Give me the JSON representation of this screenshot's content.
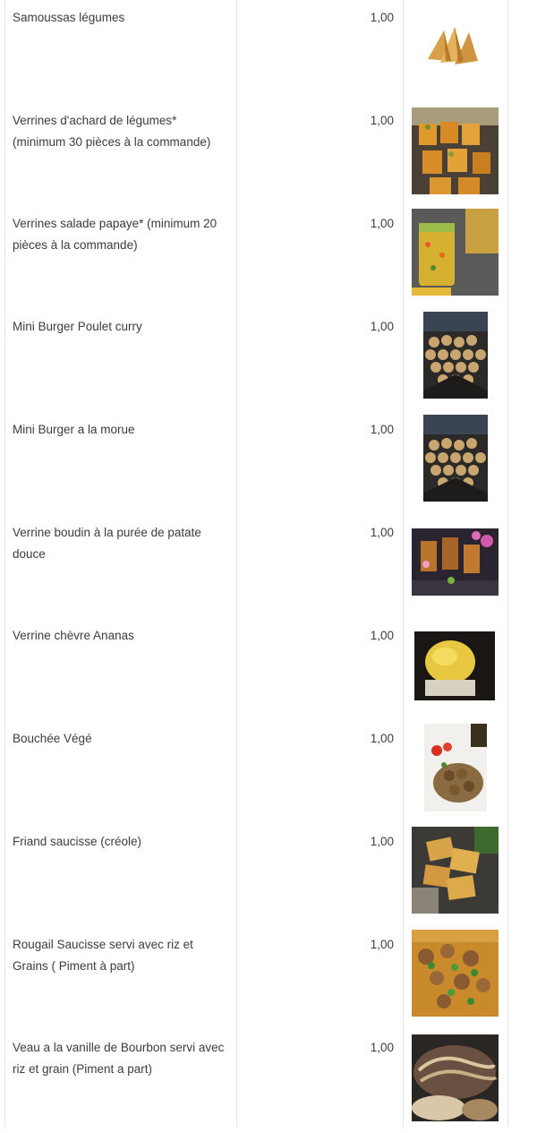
{
  "products": [
    {
      "name": "Samoussas légumes",
      "price": "1,00",
      "image": "samosa-icon"
    },
    {
      "name": "Verrines d'achard de légumes* (minimum 30 pièces à la commande)",
      "price": "1,00",
      "image": "achard-verrines-photo"
    },
    {
      "name": "Verrines salade papaye* (minimum 20 pièces à la commande)",
      "price": "1,00",
      "image": "papaya-salad-verrine-photo"
    },
    {
      "name": "Mini Burger Poulet curry",
      "price": "1,00",
      "image": "mini-burgers-photo"
    },
    {
      "name": "Mini Burger a la morue",
      "price": "1,00",
      "image": "mini-burgers-photo"
    },
    {
      "name": "Verrine boudin à la purée de patate douce",
      "price": "1,00",
      "image": "boudin-verrine-photo"
    },
    {
      "name": "Verrine chèvre Ananas",
      "price": "1,00",
      "image": "goat-cheese-pineapple-photo"
    },
    {
      "name": "Bouchée Végé",
      "price": "1,00",
      "image": "veggie-bites-photo"
    },
    {
      "name": "Friand saucisse (créole)",
      "price": "1,00",
      "image": "sausage-pastry-photo"
    },
    {
      "name": "Rougail Saucisse servi avec riz et Grains ( Piment à part)",
      "price": "1,00",
      "image": "rougail-saucisse-photo"
    },
    {
      "name": "Veau a la vanille de Bourbon servi avec riz et grain (Piment a part)",
      "price": "1,00",
      "image": "vanilla-veal-photo"
    }
  ]
}
